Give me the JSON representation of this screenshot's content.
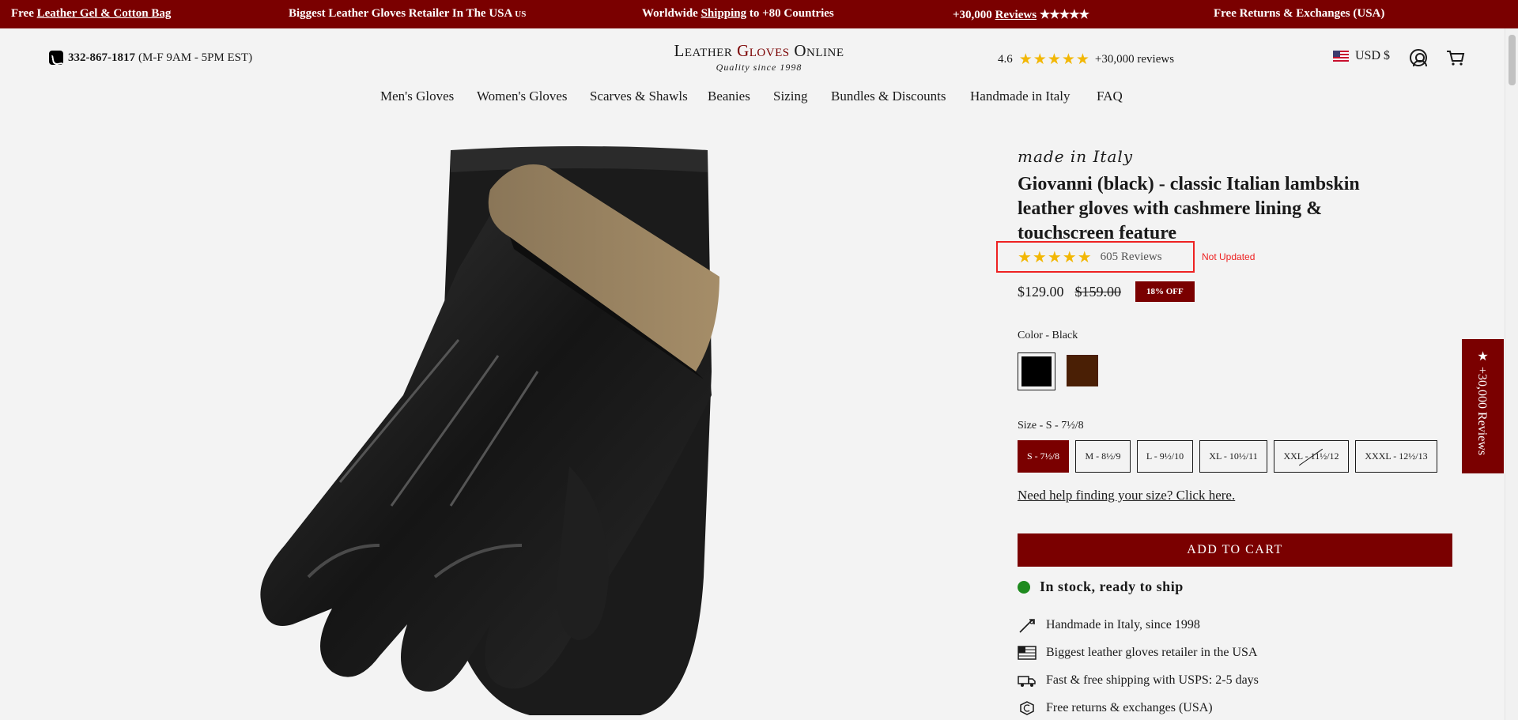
{
  "announcement": {
    "item1_prefix": "Free ",
    "item1_link": "Leather Gel & Cotton Bag",
    "item2_text": "Biggest Leather Gloves Retailer In The USA",
    "item2_badge": "US",
    "item3_prefix": "Worldwide ",
    "item3_link": "Shipping",
    "item3_suffix": " to +80 Countries",
    "item4_prefix": "+30,000 ",
    "item4_link": "Reviews",
    "item4_stars": "★★★★★",
    "item5_text": "Free Returns & Exchanges (USA)"
  },
  "header": {
    "phone_number": "332-867-1817",
    "phone_hours": "(M-F 9AM - 5PM EST)",
    "logo_part1": "Leather ",
    "logo_part2": "Gloves",
    "logo_part3": " Online",
    "logo_tagline": "Quality since 1998",
    "rating_value": "4.6",
    "rating_stars": "★★★★★",
    "rating_text": "+30,000 reviews",
    "currency": "USD $"
  },
  "nav": {
    "items": [
      "Men's Gloves",
      "Women's Gloves",
      "Scarves & Shawls",
      "Beanies",
      "Sizing",
      "Bundles & Discounts",
      "Handmade in Italy",
      "FAQ"
    ]
  },
  "product": {
    "made_in": "made in Italy",
    "title": "Giovanni (black) - classic Italian lambskin leather gloves with cashmere lining & touchscreen feature",
    "stars": "★★★★★",
    "reviews": "605 Reviews",
    "annotation": "Not Updated",
    "price": "$129.00",
    "compare_price": "$159.00",
    "discount": "18% OFF",
    "color_label": "Color - Black",
    "colors": [
      {
        "name": "Black",
        "hex": "#000000"
      },
      {
        "name": "Brown",
        "hex": "#4a1f05"
      }
    ],
    "size_label": "Size - S - 7½/8",
    "sizes": [
      "S - 7½/8",
      "M - 8½/9",
      "L - 9½/10",
      "XL - 10½/11",
      "XXL - 11½/12",
      "XXXL - 12½/13"
    ],
    "size_help": "Need help finding your size? Click here.",
    "add_to_cart": "ADD TO CART",
    "stock": "In stock, ready to ship",
    "features": [
      {
        "icon": "needle-icon",
        "text": "Handmade in Italy, since 1998"
      },
      {
        "icon": "us-flag-icon",
        "text": "Biggest leather gloves retailer in the USA"
      },
      {
        "icon": "truck-icon",
        "text": "Fast & free shipping with USPS: 2-5 days"
      },
      {
        "icon": "return-icon",
        "text": "Free returns & exchanges (USA)"
      }
    ]
  },
  "reviews_tab": "★ +30,000 Reviews",
  "colors": {
    "brand": "#7a0000",
    "star": "#f2b705",
    "stock_green": "#1e8a1e",
    "annotation_red": "#ee2222"
  }
}
